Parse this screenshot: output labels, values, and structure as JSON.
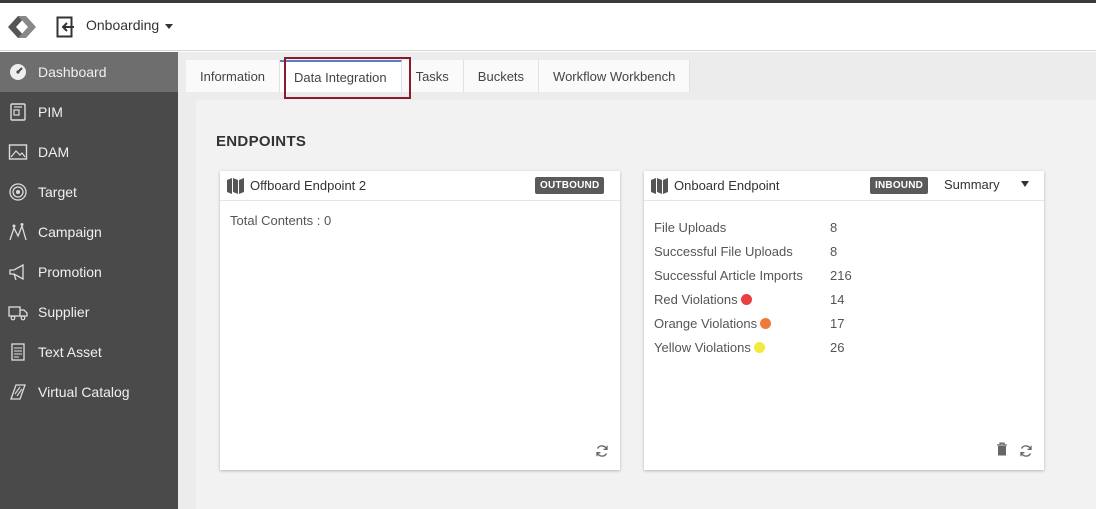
{
  "header": {
    "module": "Onboarding",
    "icons": {
      "logo": "brand-logo-icon",
      "exit": "exit-icon",
      "caret": "caret-down-icon"
    }
  },
  "sidebar": {
    "items": [
      {
        "label": "Dashboard",
        "icon": "dashboard-icon",
        "active": true
      },
      {
        "label": "PIM",
        "icon": "pim-icon",
        "active": false
      },
      {
        "label": "DAM",
        "icon": "image-icon",
        "active": false
      },
      {
        "label": "Target",
        "icon": "target-icon",
        "active": false
      },
      {
        "label": "Campaign",
        "icon": "campaign-icon",
        "active": false
      },
      {
        "label": "Promotion",
        "icon": "megaphone-icon",
        "active": false
      },
      {
        "label": "Supplier",
        "icon": "truck-icon",
        "active": false
      },
      {
        "label": "Text Asset",
        "icon": "document-icon",
        "active": false
      },
      {
        "label": "Virtual Catalog",
        "icon": "catalog-icon",
        "active": false
      }
    ]
  },
  "tabs": [
    {
      "label": "Information",
      "active": false
    },
    {
      "label": "Data Integration",
      "active": true
    },
    {
      "label": "Tasks",
      "active": false
    },
    {
      "label": "Buckets",
      "active": false
    },
    {
      "label": "Workflow Workbench",
      "active": false
    }
  ],
  "section": {
    "title": "ENDPOINTS"
  },
  "endpoints": [
    {
      "title": "Offboard Endpoint 2",
      "badge": "OUTBOUND",
      "total_contents": "Total Contents : 0"
    },
    {
      "title": "Onboard Endpoint",
      "badge": "INBOUND",
      "view": "Summary",
      "stats": [
        {
          "label": "File Uploads",
          "value": "8"
        },
        {
          "label": "Successful File Uploads",
          "value": "8"
        },
        {
          "label": "Successful Article Imports",
          "value": "216"
        },
        {
          "label": "Red Violations",
          "value": "14",
          "dot": "#e84040"
        },
        {
          "label": "Orange Violations",
          "value": "17",
          "dot": "#ee7a3a"
        },
        {
          "label": "Yellow Violations",
          "value": "26",
          "dot": "#f2ea3c"
        }
      ]
    }
  ],
  "colors": {
    "sidebar_bg": "#4a4a4a",
    "sidebar_active": "#6e6e6e",
    "tab_highlight": "#8b1a2a",
    "badge_bg": "#5a5a5a"
  }
}
